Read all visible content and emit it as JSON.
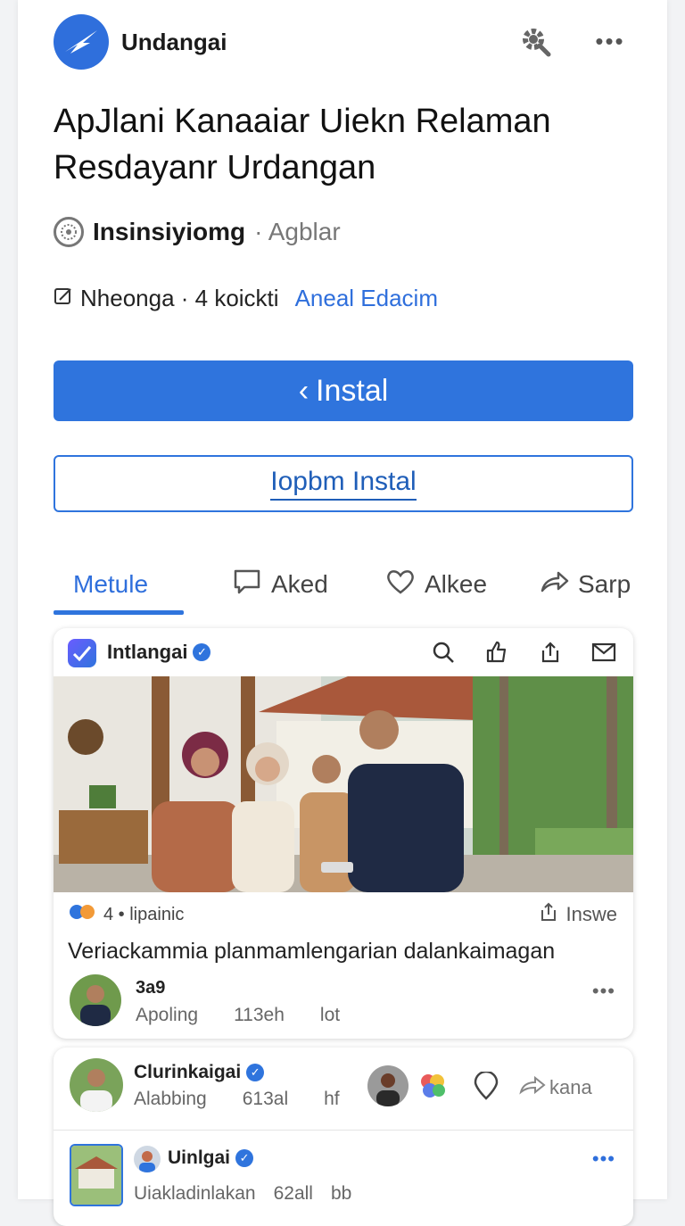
{
  "header": {
    "app_name": "Undangai",
    "more_label": "•••"
  },
  "app": {
    "title": "ApJlani Kanaaiar Uiekn Relaman Resdayanr Urdangan",
    "developer": "Insinsiyiomg",
    "developer_suffix": "· Agblar",
    "meta_text": "Nheonga · 4 koickti",
    "meta_link": "Aneal Edacim",
    "install_label": "Instal",
    "open_label": "Iopbm Instal"
  },
  "tabs": [
    {
      "label": "Metule",
      "icon": "none",
      "active": true
    },
    {
      "label": "Aked",
      "icon": "comment-icon"
    },
    {
      "label": "Alkee",
      "icon": "heart-icon"
    },
    {
      "label": "Sarp",
      "icon": "share-icon"
    }
  ],
  "post": {
    "author": "Intlangai",
    "stats": "4 • lipainic",
    "share_label": "Inswe",
    "caption": "Veriackammia planmamlengarian dalankaimagan",
    "comment": {
      "user": "3a9",
      "sub1": "Apoling",
      "sub2": "113eh",
      "sub3": "lot",
      "more": "•••"
    }
  },
  "card2": {
    "name": "Clurinkaigai",
    "sub1": "Alabbing",
    "sub2": "613al",
    "sub3": "hf",
    "share_label": "kana",
    "name2": "Uinlgai",
    "more2": "•••",
    "sub4": "Uiakladinlakan",
    "sub5": "62all",
    "sub6": "bb"
  },
  "colors": {
    "accent": "#2f74dd",
    "text": "#1a1a1a",
    "muted": "#666666"
  }
}
